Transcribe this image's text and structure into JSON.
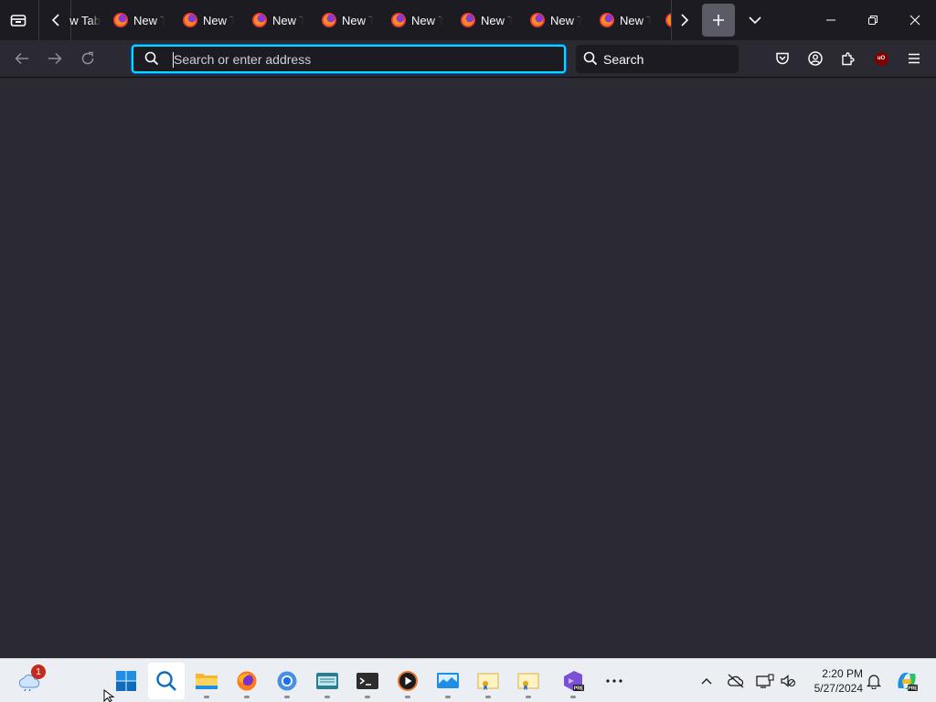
{
  "browser": {
    "tabs": [
      {
        "label": "New Tab"
      },
      {
        "label": "New Tab"
      },
      {
        "label": "New Tab"
      },
      {
        "label": "New Tab"
      },
      {
        "label": "New Tab"
      },
      {
        "label": "New Tab"
      },
      {
        "label": "New Tab"
      },
      {
        "label": "New Tab"
      },
      {
        "label": "New Tab"
      }
    ],
    "urlbar": {
      "placeholder": "Search or enter address",
      "value": ""
    },
    "searchbar": {
      "placeholder": "Search"
    },
    "ublock_badge": "uO",
    "colors": {
      "chrome": "#1c1b22",
      "toolbar": "#2b2a33",
      "focus_ring": "#00ddff",
      "content": "#2b2a33"
    }
  },
  "icons": {
    "firefox_view": "firefox-view-icon",
    "scroll_left": "chevron-left-icon",
    "scroll_right": "chevron-right-icon",
    "new_tab": "plus-icon",
    "list_tabs": "chevron-down-icon",
    "back": "back-arrow-icon",
    "forward": "forward-arrow-icon",
    "reload": "reload-icon",
    "pocket": "pocket-icon",
    "account": "account-icon",
    "extensions": "puzzle-icon",
    "menu": "hamburger-menu-icon"
  },
  "taskbar": {
    "weather_badge": "1",
    "apps": [
      {
        "name": "start"
      },
      {
        "name": "search"
      },
      {
        "name": "file-explorer"
      },
      {
        "name": "firefox"
      },
      {
        "name": "chrome"
      },
      {
        "name": "keyboard-app"
      },
      {
        "name": "terminal"
      },
      {
        "name": "media-player"
      },
      {
        "name": "monitor-app"
      },
      {
        "name": "certificate-app-1"
      },
      {
        "name": "certificate-app-2"
      },
      {
        "name": "visual-studio-preview"
      },
      {
        "name": "more-apps"
      }
    ],
    "clock": {
      "time": "2:20 PM",
      "date": "5/27/2024"
    },
    "accent": "#0078d4"
  }
}
